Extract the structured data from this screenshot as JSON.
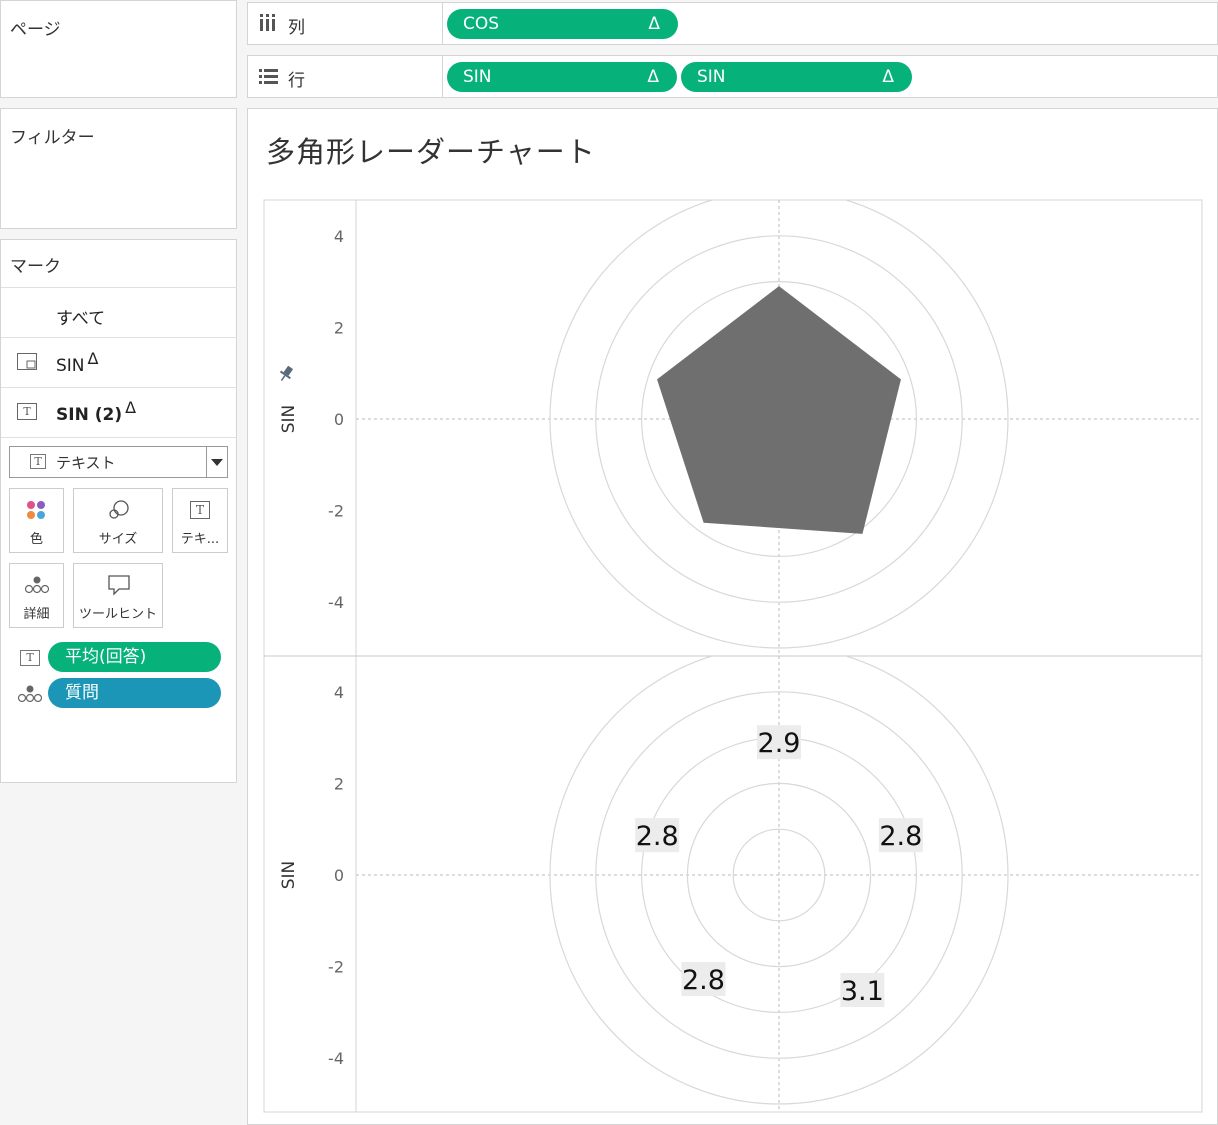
{
  "pages": {
    "title": "ページ"
  },
  "filters": {
    "title": "フィルター"
  },
  "marks": {
    "title": "マーク",
    "all_label": "すべて",
    "layers": [
      {
        "label": "SIN",
        "delta": "Δ"
      },
      {
        "label": "SIN (2)",
        "delta": "Δ"
      }
    ],
    "mark_type": "テキスト",
    "buttons": {
      "color": "色",
      "size": "サイズ",
      "text": "テキ...",
      "detail": "詳細",
      "tooltip": "ツールヒント"
    },
    "fields": [
      {
        "label": "平均(回答)",
        "color": "#07b27a"
      },
      {
        "label": "質問",
        "color": "#1b96b6"
      }
    ]
  },
  "shelves": {
    "columns": {
      "label": "列",
      "pills": [
        {
          "label": "COS",
          "delta": "Δ"
        }
      ]
    },
    "rows": {
      "label": "行",
      "pills": [
        {
          "label": "SIN",
          "delta": "Δ"
        },
        {
          "label": "SIN",
          "delta": "Δ"
        }
      ]
    }
  },
  "view": {
    "title": "多角形レーダーチャート"
  },
  "chart_data": {
    "type": "scatter",
    "panes": [
      {
        "mark": "polygon",
        "ylabel": "SIN",
        "ylim": [
          -5,
          5
        ],
        "xlim": [
          -5,
          5
        ],
        "y_ticks": [
          "4",
          "2",
          "0",
          "-2",
          "-4"
        ],
        "rings": [
          1,
          2,
          3,
          4,
          5
        ],
        "polygon_values": [
          2.9,
          2.8,
          3.1,
          2.8,
          2.8
        ],
        "fill": "#6f6f6f"
      },
      {
        "mark": "text",
        "ylabel": "SIN",
        "ylim": [
          -5,
          5
        ],
        "xlim": [
          -5,
          5
        ],
        "y_ticks": [
          "4",
          "2",
          "0",
          "-2",
          "-4"
        ],
        "rings": [
          1,
          2,
          3,
          4,
          5
        ],
        "labels": [
          {
            "text": "2.9",
            "x": 0.0,
            "y": 2.9
          },
          {
            "text": "2.8",
            "x": 2.66,
            "y": 0.87
          },
          {
            "text": "3.1",
            "x": 1.82,
            "y": -2.51
          },
          {
            "text": "2.8",
            "x": -1.65,
            "y": -2.27
          },
          {
            "text": "2.8",
            "x": -2.66,
            "y": 0.87
          }
        ]
      }
    ]
  },
  "colors": {
    "pill_green": "#07b27a",
    "pill_blue": "#1b96b6",
    "grid": "#d8d8d8"
  }
}
